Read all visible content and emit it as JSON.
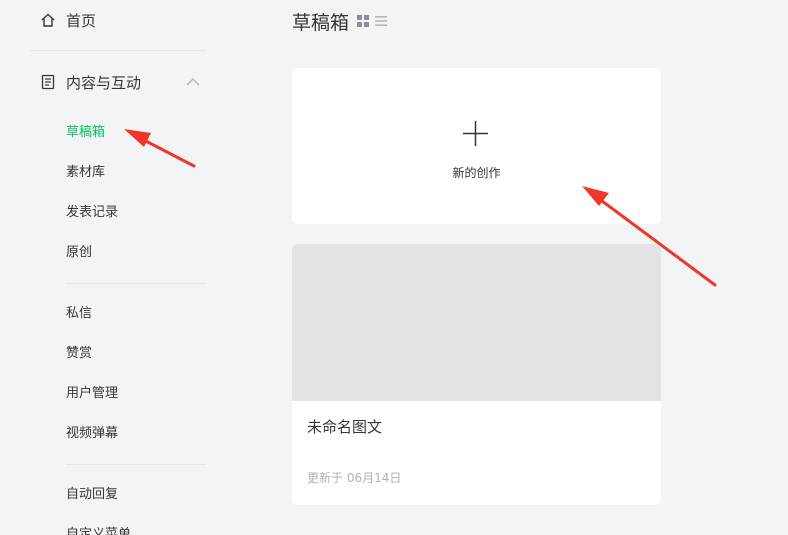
{
  "sidebar": {
    "home_label": "首页",
    "section_label": "内容与互动",
    "items": [
      {
        "label": "草稿箱"
      },
      {
        "label": "素材库"
      },
      {
        "label": "发表记录"
      },
      {
        "label": "原创"
      },
      {
        "label": "私信"
      },
      {
        "label": "赞赏"
      },
      {
        "label": "用户管理"
      },
      {
        "label": "视频弹幕"
      },
      {
        "label": "自动回复"
      },
      {
        "label": "自定义菜单"
      }
    ]
  },
  "main": {
    "title": "草稿箱",
    "new_card_label": "新的创作",
    "draft": {
      "title": "未命名图文",
      "updated": "更新于 06月14日"
    }
  },
  "colors": {
    "accent": "#07c160",
    "annotation_arrow": "#f0352a"
  }
}
